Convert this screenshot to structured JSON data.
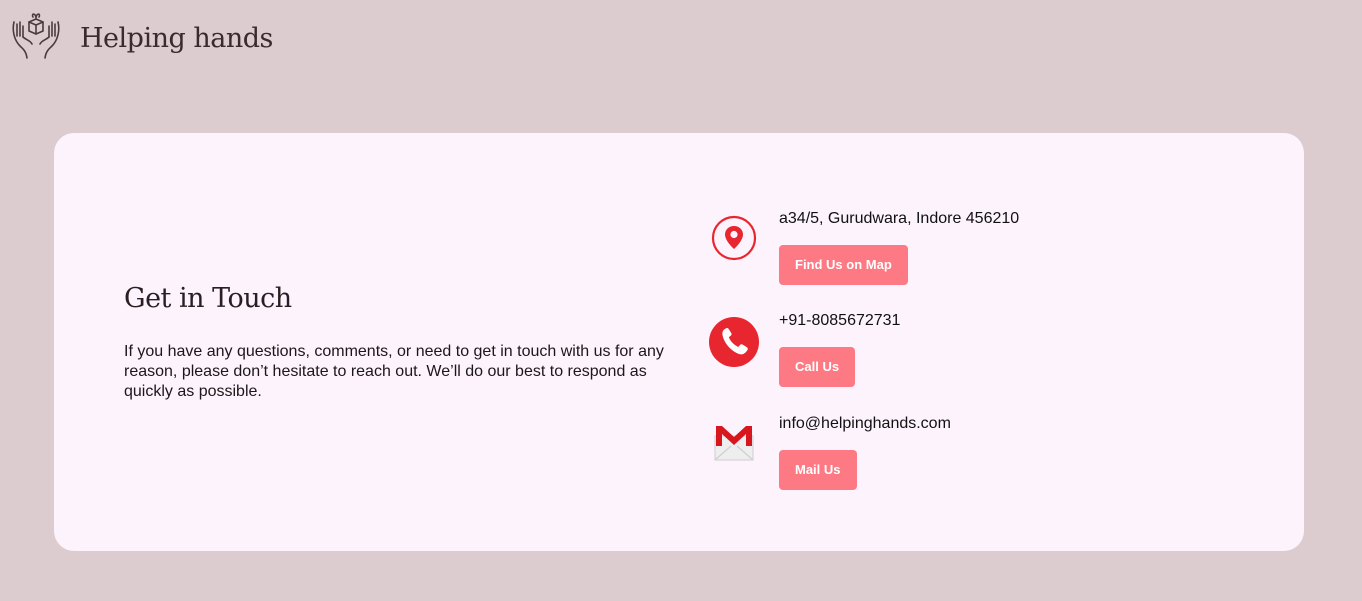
{
  "header": {
    "logo_icon": "hands-holding-gift-icon",
    "brand_name": "Helping hands"
  },
  "intro": {
    "title": "Get in Touch",
    "description": "If you have any questions, comments, or need to get in touch with us for any reason, please don’t hesitate to reach out. We’ll do our best to respond as quickly as possible."
  },
  "contacts": [
    {
      "icon": "location-pin-icon",
      "value": "a34/5, Gurudwara, Indore 456210",
      "button_label": "Find Us on Map"
    },
    {
      "icon": "phone-icon",
      "value": "+91-8085672731",
      "button_label": "Call Us"
    },
    {
      "icon": "gmail-icon",
      "value": "info@helpinghands.com",
      "button_label": "Mail Us"
    }
  ],
  "colors": {
    "page_background": "#dccbcf",
    "card_background": "#fdf3fd",
    "button": "#fd7a84",
    "icon_red": "#e8262f"
  }
}
